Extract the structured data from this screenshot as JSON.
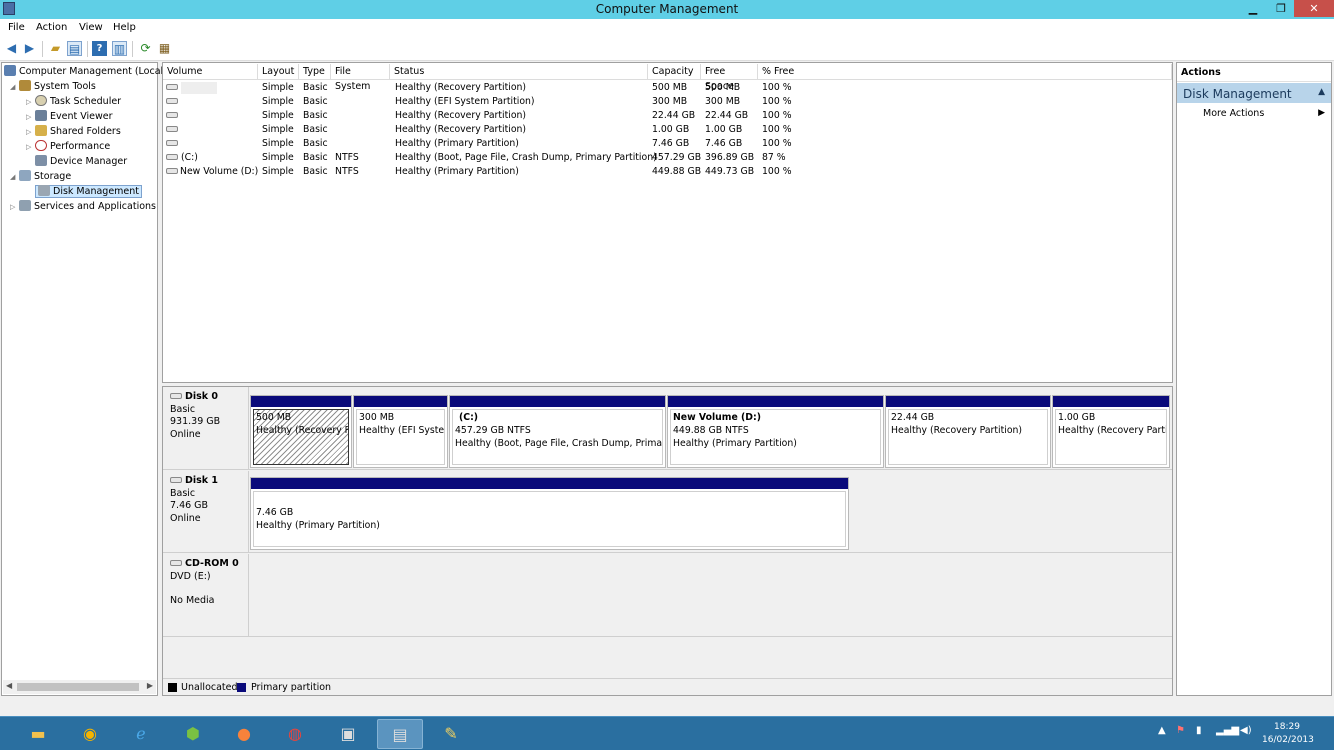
{
  "window": {
    "title": "Computer Management",
    "min": "▁",
    "max": "❐",
    "close": "✕"
  },
  "menu": [
    "File",
    "Action",
    "View",
    "Help"
  ],
  "tree": {
    "root": "Computer Management (Local",
    "system_tools": "System Tools",
    "task_scheduler": "Task Scheduler",
    "event_viewer": "Event Viewer",
    "shared_folders": "Shared Folders",
    "performance": "Performance",
    "device_manager": "Device Manager",
    "storage": "Storage",
    "disk_management": "Disk Management",
    "services": "Services and Applications"
  },
  "volumes": {
    "headers": [
      "Volume",
      "Layout",
      "Type",
      "File System",
      "Status",
      "Capacity",
      "Free Space",
      "% Free"
    ],
    "rows": [
      [
        "",
        "Simple",
        "Basic",
        "",
        "Healthy (Recovery Partition)",
        "500 MB",
        "500 MB",
        "100 %"
      ],
      [
        "",
        "Simple",
        "Basic",
        "",
        "Healthy (EFI System Partition)",
        "300 MB",
        "300 MB",
        "100 %"
      ],
      [
        "",
        "Simple",
        "Basic",
        "",
        "Healthy (Recovery Partition)",
        "22.44 GB",
        "22.44 GB",
        "100 %"
      ],
      [
        "",
        "Simple",
        "Basic",
        "",
        "Healthy (Recovery Partition)",
        "1.00 GB",
        "1.00 GB",
        "100 %"
      ],
      [
        "",
        "Simple",
        "Basic",
        "",
        "Healthy (Primary Partition)",
        "7.46 GB",
        "7.46 GB",
        "100 %"
      ],
      [
        "(C:)",
        "Simple",
        "Basic",
        "NTFS",
        "Healthy (Boot, Page File, Crash Dump, Primary Partition)",
        "457.29 GB",
        "396.89 GB",
        "87 %"
      ],
      [
        "New Volume (D:)",
        "Simple",
        "Basic",
        "NTFS",
        "Healthy (Primary Partition)",
        "449.88 GB",
        "449.73 GB",
        "100 %"
      ]
    ]
  },
  "disks": {
    "disk0": {
      "name": "Disk 0",
      "type": "Basic",
      "size": "931.39 GB",
      "status": "Online"
    },
    "disk1": {
      "name": "Disk 1",
      "type": "Basic",
      "size": "7.46 GB",
      "status": "Online"
    },
    "cdrom": {
      "name": "CD-ROM 0",
      "type": "DVD (E:)",
      "status": "No Media"
    }
  },
  "partitions": {
    "p1": {
      "size": "500 MB",
      "status": "Healthy (Recovery Pa"
    },
    "p2": {
      "size": "300 MB",
      "status": "Healthy (EFI Syster"
    },
    "p3": {
      "label": "(C:)",
      "size": "457.29 GB NTFS",
      "status": "Healthy (Boot, Page File, Crash Dump, Primary"
    },
    "p4": {
      "label": "New Volume  (D:)",
      "size": "449.88 GB NTFS",
      "status": "Healthy (Primary Partition)"
    },
    "p5": {
      "size": "22.44 GB",
      "status": "Healthy (Recovery Partition)"
    },
    "p6": {
      "size": "1.00 GB",
      "status": "Healthy (Recovery Partit"
    },
    "d1": {
      "size": "7.46 GB",
      "status": "Healthy (Primary Partition)"
    }
  },
  "legend": {
    "unallocated": "Unallocated",
    "primary": "Primary partition",
    "unallocated_color": "#000000",
    "primary_color": "#0a0a7a"
  },
  "actions": {
    "header": "Actions",
    "section": "Disk Management",
    "more": "More Actions"
  },
  "clock": {
    "time": "18:29",
    "date": "16/02/2013"
  }
}
